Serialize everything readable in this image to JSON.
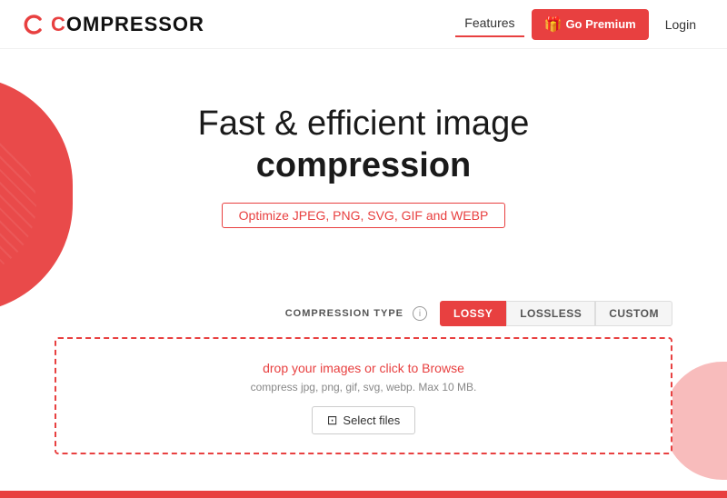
{
  "navbar": {
    "logo_text": "COMPRESSOR",
    "logo_c": "C",
    "features_label": "Features",
    "premium_label": "Go Premium",
    "premium_emoji": "🎁",
    "login_label": "Login"
  },
  "hero": {
    "title_line1": "Fast & efficient image",
    "title_line2": "compression",
    "subtitle": "Optimize JPEG, PNG, SVG, GIF and WEBP"
  },
  "compression": {
    "label": "COMPRESSION TYPE",
    "info_char": "i",
    "types": [
      {
        "id": "lossy",
        "label": "LOSSY",
        "active": true
      },
      {
        "id": "lossless",
        "label": "LOSSLESS",
        "active": false
      },
      {
        "id": "custom",
        "label": "CUSTOM",
        "active": false
      }
    ]
  },
  "dropzone": {
    "main_text": "drop your images or click to Browse",
    "sub_text": "compress jpg, png, gif, svg, webp. Max 10 MB.",
    "select_label": "Select files"
  }
}
